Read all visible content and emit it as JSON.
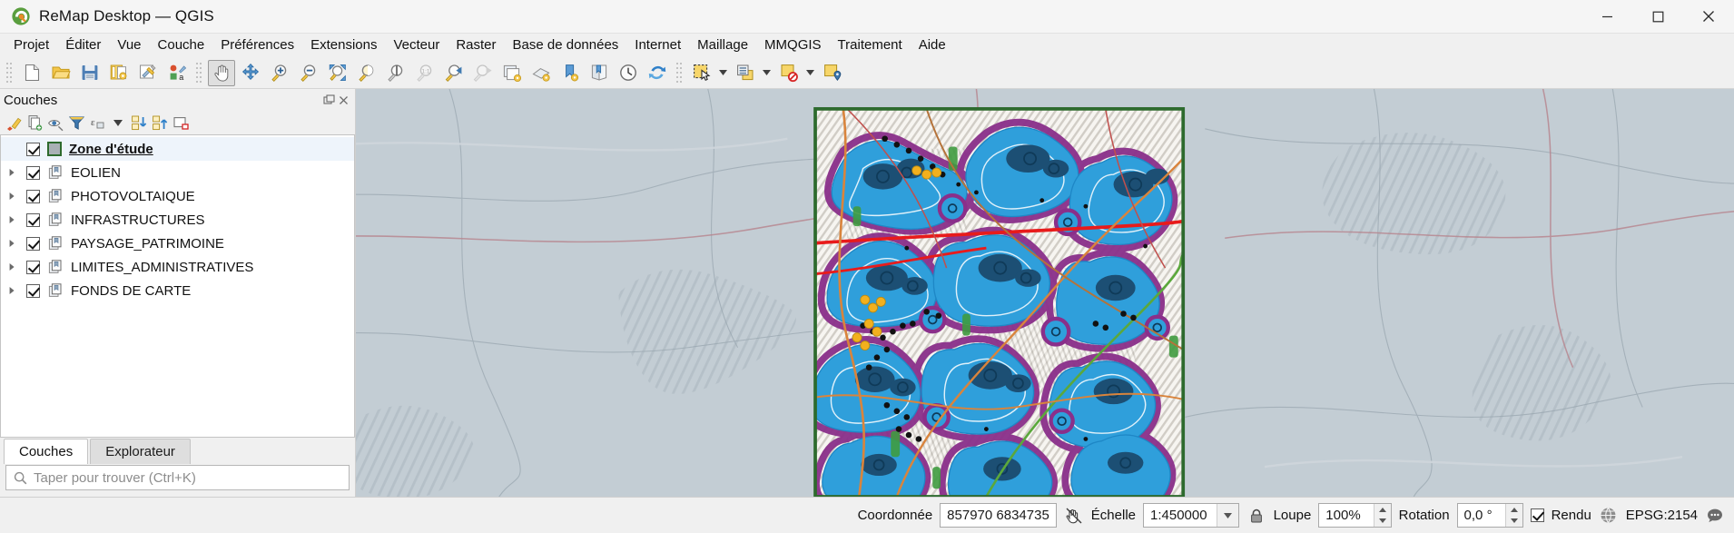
{
  "window": {
    "title": "ReMap Desktop — QGIS",
    "logo_icon": "qgis-logo-icon",
    "minimize_label": "─",
    "maximize_label": "☐",
    "close_label": "✕"
  },
  "menubar": {
    "items": [
      {
        "label": "Projet",
        "accel": "P"
      },
      {
        "label": "Éditer",
        "accel": "É"
      },
      {
        "label": "Vue",
        "accel": "V"
      },
      {
        "label": "Couche",
        "accel": "C"
      },
      {
        "label": "Préférences",
        "accel": "P"
      },
      {
        "label": "Extensions",
        "accel": "E"
      },
      {
        "label": "Vecteur",
        "accel": "V"
      },
      {
        "label": "Raster",
        "accel": "R"
      },
      {
        "label": "Base de données",
        "accel": "B"
      },
      {
        "label": "Internet",
        "accel": "I"
      },
      {
        "label": "Maillage",
        "accel": "M"
      },
      {
        "label": "MMQGIS",
        "accel": ""
      },
      {
        "label": "Traitement",
        "accel": "T"
      },
      {
        "label": "Aide",
        "accel": "A"
      }
    ]
  },
  "toolbar": {
    "groups": [
      {
        "name": "project-toolbar",
        "buttons": [
          {
            "icon": "new-project-icon",
            "title": "Nouveau projet",
            "active": false,
            "disabled": false
          },
          {
            "icon": "open-project-icon",
            "title": "Ouvrir un projet",
            "active": false,
            "disabled": false
          },
          {
            "icon": "save-project-icon",
            "title": "Enregistrer le projet",
            "active": false,
            "disabled": false
          },
          {
            "icon": "layout-manager-icon",
            "title": "Gestionnaire de mises en page",
            "active": false,
            "disabled": false
          },
          {
            "icon": "new-print-layout-icon",
            "title": "Nouvelle mise en page",
            "active": false,
            "disabled": false
          },
          {
            "icon": "style-manager-icon",
            "title": "Gestionnaire de styles",
            "active": false,
            "disabled": false
          }
        ]
      },
      {
        "name": "map-navigation-toolbar",
        "buttons": [
          {
            "icon": "pan-map-icon",
            "title": "Déplacer la carte",
            "active": true,
            "disabled": false
          },
          {
            "icon": "pan-to-selection-icon",
            "title": "Déplacer vers la sélection",
            "active": false,
            "disabled": false
          },
          {
            "icon": "zoom-in-icon",
            "title": "Zoom avant",
            "active": false,
            "disabled": false
          },
          {
            "icon": "zoom-out-icon",
            "title": "Zoom arrière",
            "active": false,
            "disabled": false
          },
          {
            "icon": "zoom-full-icon",
            "title": "Zoom sur l'emprise totale",
            "active": false,
            "disabled": false
          },
          {
            "icon": "zoom-selection-icon",
            "title": "Zoom sur la sélection",
            "active": false,
            "disabled": false
          },
          {
            "icon": "zoom-layer-icon",
            "title": "Zoom sur la couche",
            "active": false,
            "disabled": false
          },
          {
            "icon": "zoom-native-icon",
            "title": "Zoom à la résolution native (1:1)",
            "active": false,
            "disabled": true
          },
          {
            "icon": "zoom-last-icon",
            "title": "Zoom précédent",
            "active": false,
            "disabled": false
          },
          {
            "icon": "zoom-next-icon",
            "title": "Zoom suivant",
            "active": false,
            "disabled": true
          },
          {
            "icon": "new-map-view-icon",
            "title": "Nouvelle vue carte",
            "active": false,
            "disabled": false
          },
          {
            "icon": "new-3d-map-view-icon",
            "title": "Nouvelle vue carte 3D",
            "active": false,
            "disabled": false
          },
          {
            "icon": "bookmark-add-icon",
            "title": "Nouveau signet spatial",
            "active": false,
            "disabled": false
          },
          {
            "icon": "bookmark-show-icon",
            "title": "Afficher les signets",
            "active": false,
            "disabled": false
          },
          {
            "icon": "temporal-controller-icon",
            "title": "Contrôleur temporel",
            "active": false,
            "disabled": false
          },
          {
            "icon": "refresh-icon",
            "title": "Rafraîchir",
            "active": false,
            "disabled": false
          }
        ]
      },
      {
        "name": "selection-toolbar",
        "buttons": [
          {
            "icon": "select-features-icon",
            "title": "Sélectionner des entités",
            "active": false,
            "disabled": false,
            "dropdown": true
          },
          {
            "icon": "select-by-form-icon",
            "title": "Sélectionner par formulaire",
            "active": false,
            "disabled": false,
            "dropdown": true
          },
          {
            "icon": "deselect-all-icon",
            "title": "Désélectionner tout",
            "active": false,
            "disabled": false,
            "dropdown": true
          },
          {
            "icon": "identify-features-icon",
            "title": "Identifier les entités",
            "active": false,
            "disabled": false,
            "dropdown": false
          }
        ]
      }
    ]
  },
  "panel": {
    "title": "Couches",
    "float_icon": "undock-icon",
    "close_icon": "close-icon",
    "toolbar": [
      {
        "icon": "open-layer-styling-icon",
        "title": "Ouvrir le panneau de style de couche"
      },
      {
        "icon": "add-group-icon",
        "title": "Ajouter un groupe"
      },
      {
        "icon": "manage-visibility-icon",
        "title": "Gérer la visibilité des couches"
      },
      {
        "icon": "filter-legend-icon",
        "title": "Filtrer la légende par contenu de la carte"
      },
      {
        "icon": "filter-expression-icon",
        "title": "Filtrer la légende par expression"
      },
      {
        "icon": "filter-dropdown-icon",
        "title": "Options de filtre"
      },
      {
        "icon": "expand-all-icon",
        "title": "Tout développer"
      },
      {
        "icon": "collapse-all-icon",
        "title": "Tout réduire"
      },
      {
        "icon": "remove-layer-icon",
        "title": "Supprimer la couche/le groupe"
      }
    ],
    "layers": [
      {
        "name": "Zone d'étude",
        "checked": true,
        "type": "polygon-layer",
        "expandable": false,
        "selected": true,
        "bold": true,
        "icon": "polygon-swatch-icon"
      },
      {
        "name": "EOLIEN",
        "checked": true,
        "type": "group",
        "expandable": true,
        "selected": false,
        "bold": false,
        "icon": "layer-group-icon"
      },
      {
        "name": "PHOTOVOLTAIQUE",
        "checked": true,
        "type": "group",
        "expandable": true,
        "selected": false,
        "bold": false,
        "icon": "layer-group-icon"
      },
      {
        "name": "INFRASTRUCTURES",
        "checked": true,
        "type": "group",
        "expandable": true,
        "selected": false,
        "bold": false,
        "icon": "layer-group-icon"
      },
      {
        "name": "PAYSAGE_PATRIMOINE",
        "checked": true,
        "type": "group",
        "expandable": true,
        "selected": false,
        "bold": false,
        "icon": "layer-group-icon"
      },
      {
        "name": "LIMITES_ADMINISTRATIVES",
        "checked": true,
        "type": "group",
        "expandable": true,
        "selected": false,
        "bold": false,
        "icon": "layer-group-icon"
      },
      {
        "name": "FONDS DE CARTE",
        "checked": true,
        "type": "group",
        "expandable": true,
        "selected": false,
        "bold": false,
        "icon": "layer-group-icon"
      }
    ],
    "tabs": [
      {
        "label": "Couches",
        "active": true
      },
      {
        "label": "Explorateur",
        "active": false
      }
    ],
    "locator": {
      "icon": "search-icon",
      "placeholder": "Taper pour trouver (Ctrl+K)",
      "value": ""
    }
  },
  "statusbar": {
    "coordinate_label": "Coordonnée",
    "coordinate_value": "857970 6834735",
    "toggle_extents_icon": "toggle-extents-icon",
    "scale_label": "Échelle",
    "scale_value": "1:450000",
    "scale_dropdown_icon": "chevron-down-icon",
    "lock_icon": "lock-scale-icon",
    "magnifier_label": "Loupe",
    "magnifier_value": "100%",
    "rotation_label": "Rotation",
    "rotation_value": "0,0 °",
    "render_label": "Rendu",
    "render_checked": true,
    "crs_icon": "globe-icon",
    "crs_label": "EPSG:2154",
    "messages_icon": "messages-icon"
  },
  "map": {
    "background_color": "#c3cdd4",
    "study_area_border_color": "#2d6a2d",
    "buffer_fill_color": "#2f9fdb",
    "buffer_outer_color": "#8a2f8a",
    "core_color": "#1c4f74",
    "road_primary_color": "#e81b1b",
    "road_secondary_color": "#d9843c",
    "railway_color": "#5ba83c",
    "forest_color": "#3f9b3f",
    "point_marker_color": "#111111",
    "solar_marker_color": "#f2b01e",
    "urban_color": "#f3f1ec"
  }
}
